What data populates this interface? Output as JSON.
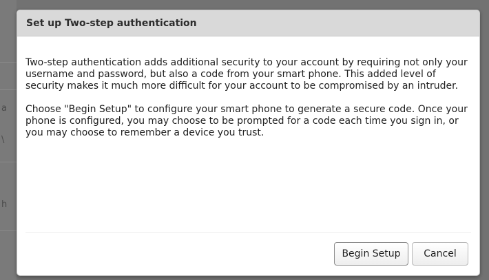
{
  "dialog": {
    "title": "Set up Two-step authentication",
    "paragraphs": [
      "Two-step authentication adds additional security to your account by requiring not only your username and password, but also a code from your smart phone. This added level of security makes it much more difficult for your account to be compromised by an intruder.",
      "Choose \"Begin Setup\" to configure your smart phone to generate a secure code. Once your phone is configured, you may choose to be prompted for a code each time you sign in, or you may choose to remember a device you trust."
    ],
    "buttons": {
      "begin_setup": "Begin Setup",
      "cancel": "Cancel"
    }
  },
  "background": {
    "glimpse_chars": [
      "a",
      "\\",
      "h"
    ]
  }
}
